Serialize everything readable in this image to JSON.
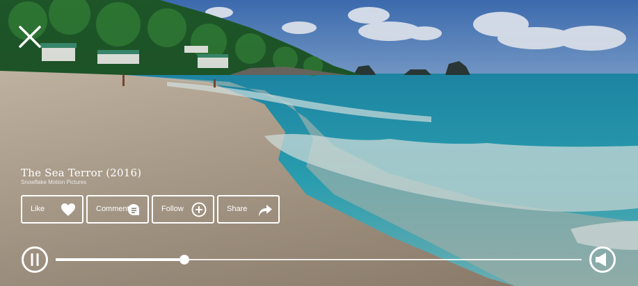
{
  "video": {
    "title": "The Sea Terror (2016)",
    "studio": "Snowflake Motion Pictures"
  },
  "actions": [
    {
      "id": "like",
      "label": "Like",
      "icon": "heart-icon"
    },
    {
      "id": "comment",
      "label": "Comment",
      "icon": "comment-icon"
    },
    {
      "id": "follow",
      "label": "Follow",
      "icon": "plus-circle-icon"
    },
    {
      "id": "share",
      "label": "Share",
      "icon": "share-arrow-icon"
    }
  ],
  "player": {
    "state": "playing",
    "progress": 0.245,
    "controls": [
      "pause-icon",
      "volume-icon"
    ]
  },
  "colors": {
    "sky": "#5b86c4",
    "sea": "#2fb4c8",
    "sand": "#b9a791",
    "foreground": "#ffffff"
  }
}
